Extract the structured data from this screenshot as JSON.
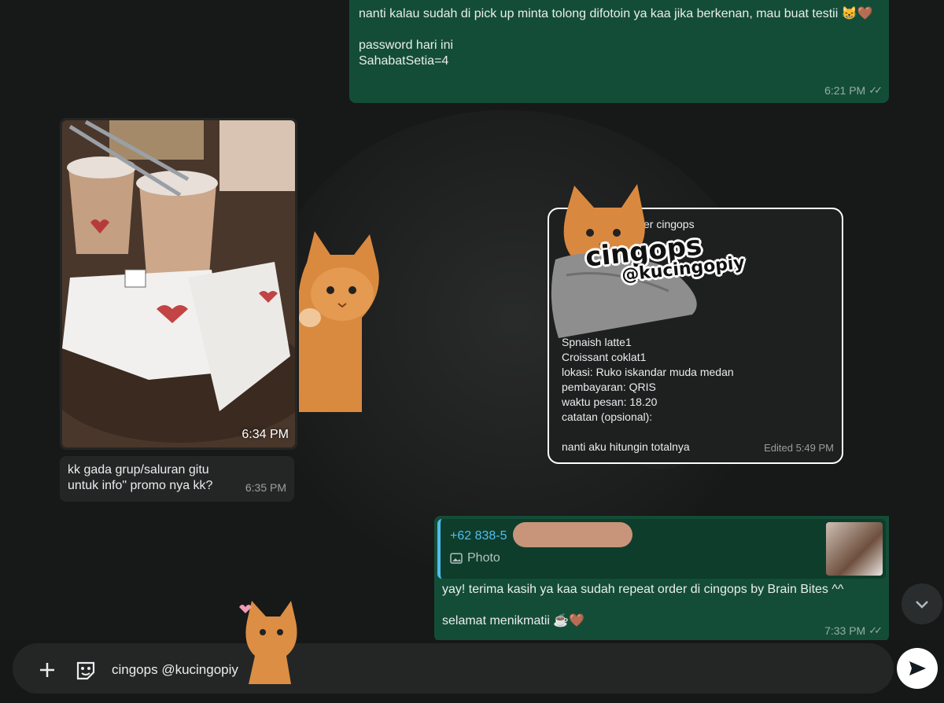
{
  "messages": {
    "m1": {
      "text": "nanti kalau sudah di pick up minta tolong difotoin ya kaa jika berkenan, mau buat testii 😸🤎\n\npassword hari ini\nSahabatSetia=4",
      "time": "6:21 PM"
    },
    "photo": {
      "time": "6:34 PM"
    },
    "kk": {
      "text": "kk gada grup/saluran gitu untuk info\" promo nya kk?",
      "time": "6:35 PM"
    },
    "card": {
      "header": "er cingops",
      "lines": [
        "Spnaish latte1",
        "Croissant coklat1",
        "lokasi: Ruko iskandar muda medan",
        "pembayaran: QRIS",
        "waktu pesan: 18.20",
        "catatan (opsional):",
        "",
        "nanti aku hitungin totalnya"
      ],
      "edited": "Edited 5:49 PM",
      "brand_title": "cingops",
      "brand_handle": "@kucingopiy"
    },
    "reply": {
      "quoted_name": "+62 838-5",
      "quoted_media": "Photo",
      "text": "yay! terima kasih ya kaa sudah repeat order di cingops by Brain Bites ^^\n\nselamat menikmatii ☕🤎",
      "time": "7:33 PM"
    }
  },
  "composer": {
    "text": "cingops @kucingopiy"
  },
  "colors": {
    "outgoing": "#144d37",
    "incoming": "#242626",
    "accent": "#53bdeb"
  }
}
